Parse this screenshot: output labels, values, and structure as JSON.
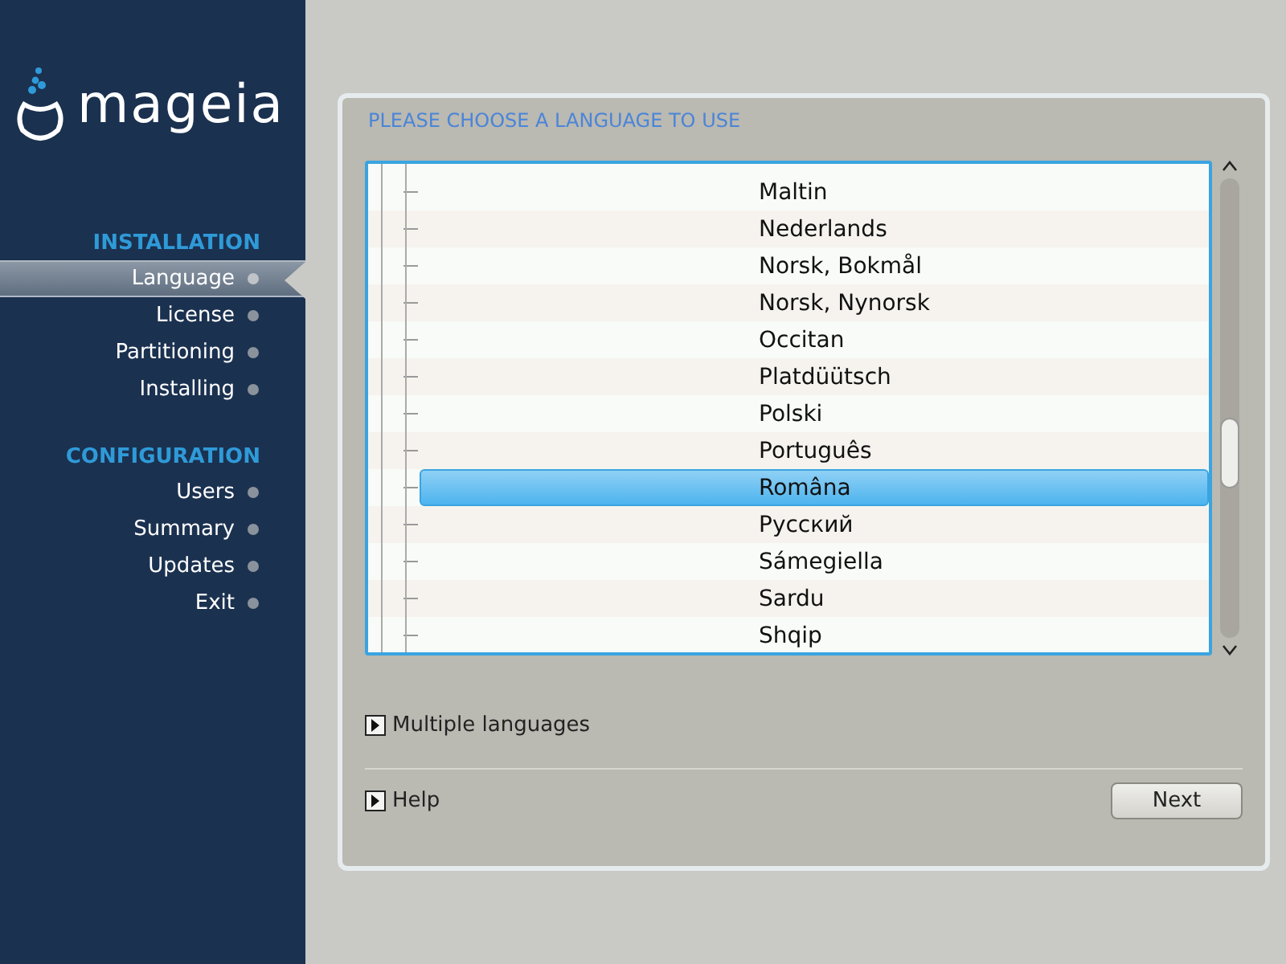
{
  "logo": {
    "text": "mageia"
  },
  "sidebar": {
    "sections": [
      {
        "title": "INSTALLATION",
        "items": [
          {
            "label": "Language",
            "selected": true
          },
          {
            "label": "License",
            "selected": false
          },
          {
            "label": "Partitioning",
            "selected": false
          },
          {
            "label": "Installing",
            "selected": false
          }
        ]
      },
      {
        "title": "CONFIGURATION",
        "items": [
          {
            "label": "Users",
            "selected": false
          },
          {
            "label": "Summary",
            "selected": false
          },
          {
            "label": "Updates",
            "selected": false
          },
          {
            "label": "Exit",
            "selected": false
          }
        ]
      }
    ]
  },
  "panel": {
    "title": "PLEASE CHOOSE A LANGUAGE TO USE",
    "languages": [
      {
        "label": "Maltin",
        "selected": false
      },
      {
        "label": "Nederlands",
        "selected": false
      },
      {
        "label": "Norsk, Bokmål",
        "selected": false
      },
      {
        "label": "Norsk, Nynorsk",
        "selected": false
      },
      {
        "label": "Occitan",
        "selected": false
      },
      {
        "label": "Platdüütsch",
        "selected": false
      },
      {
        "label": "Polski",
        "selected": false
      },
      {
        "label": "Português",
        "selected": false
      },
      {
        "label": "Româna",
        "selected": true
      },
      {
        "label": "Русский",
        "selected": false
      },
      {
        "label": "Sámegiella",
        "selected": false
      },
      {
        "label": "Sardu",
        "selected": false
      },
      {
        "label": "Shqip",
        "selected": false
      }
    ],
    "expanders": [
      {
        "label": "Multiple languages",
        "expanded": false
      },
      {
        "label": "Help",
        "expanded": false
      }
    ],
    "next_button": "Next"
  }
}
